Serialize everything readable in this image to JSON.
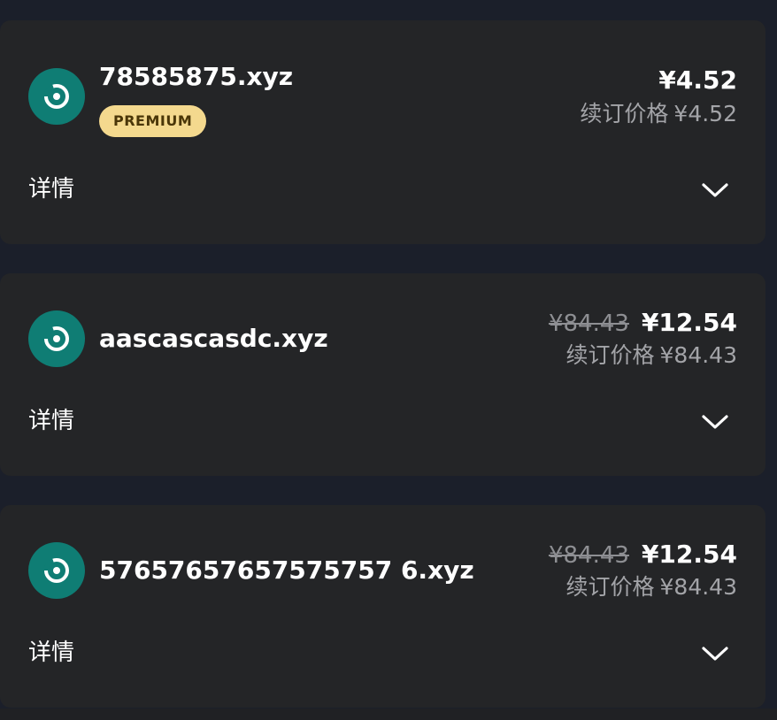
{
  "domains": [
    {
      "name": "78585875.xyz",
      "badge": "PREMIUM",
      "price_original": "",
      "price_current": "¥4.52",
      "renew_label": "续订价格",
      "renew_price": "¥4.52",
      "details_label": "详情",
      "icon": "domain-disc-icon",
      "toggle_icon": "chevron-down-icon"
    },
    {
      "name": "aascascasdc.xyz",
      "badge": "",
      "price_original": "¥84.43",
      "price_current": "¥12.54",
      "renew_label": "续订价格",
      "renew_price": "¥84.43",
      "details_label": "详情",
      "icon": "domain-disc-icon",
      "toggle_icon": "chevron-down-icon"
    },
    {
      "name": "57657657657575757 6.xyz",
      "badge": "",
      "price_original": "¥84.43",
      "price_current": "¥12.54",
      "renew_label": "续订价格",
      "renew_price": "¥84.43",
      "details_label": "详情",
      "icon": "domain-disc-icon",
      "toggle_icon": "chevron-down-icon"
    }
  ],
  "colors": {
    "background": "#1b1f2a",
    "card": "#242527",
    "icon_circle": "#0f7d74",
    "badge_bg": "#f4d98e",
    "badge_text": "#4a3608",
    "muted_text": "#a3a4a8"
  }
}
